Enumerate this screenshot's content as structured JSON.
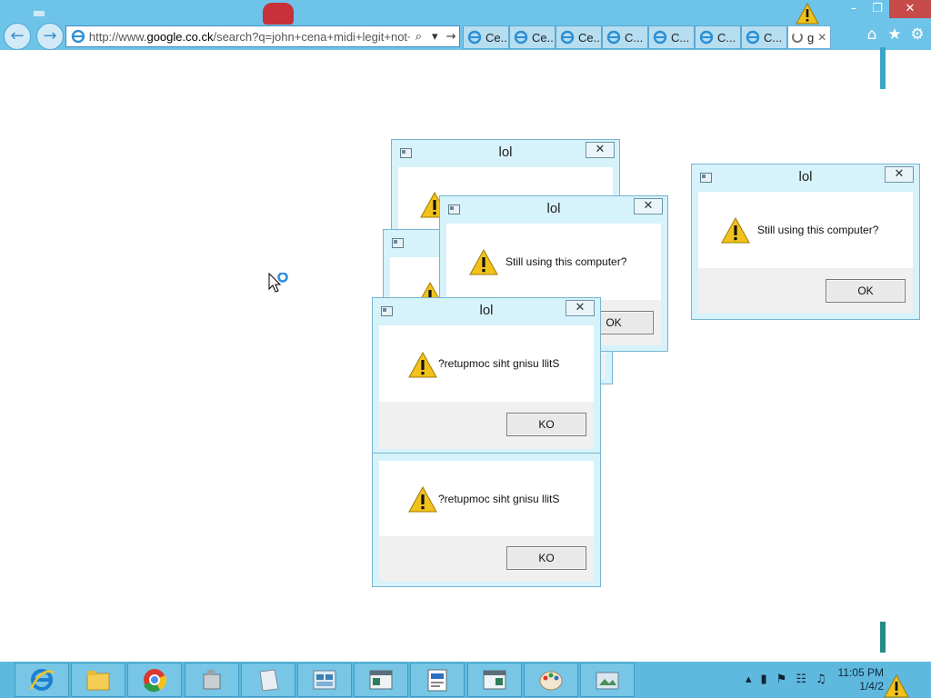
{
  "browser": {
    "address_url": "http://www.google.co.ck/search?q=john+cena+midi+legit+not+cc",
    "address_url_host": "google.co.ck",
    "address_url_prefix": "http://www.",
    "address_url_suffix": "/search?q=john+cena+midi+legit+not+cc",
    "tabs": [
      {
        "label": "Ce..."
      },
      {
        "label": "Ce..."
      },
      {
        "label": "Ce..."
      },
      {
        "label": "C..."
      },
      {
        "label": "C..."
      },
      {
        "label": "C..."
      },
      {
        "label": "C..."
      }
    ],
    "active_tab_label": "g",
    "icons": {
      "back": "back-arrow-icon",
      "forward": "forward-arrow-icon",
      "search": "search-icon",
      "home": "home-icon",
      "favorites": "star-icon",
      "settings": "gear-icon"
    }
  },
  "dialogs": [
    {
      "id": "d1",
      "title": "lol",
      "message": "",
      "button": ""
    },
    {
      "id": "d2",
      "title": "lol",
      "message": "Still using this computer?",
      "button": "OK"
    },
    {
      "id": "d3",
      "title": "",
      "message": "",
      "button": ""
    },
    {
      "id": "d4",
      "title": "lol",
      "message": "?retupmoc siht gnisu llitS",
      "button": "KO"
    },
    {
      "id": "d5",
      "title": "",
      "message": "?retupmoc siht gnisu llitS",
      "button": "KO"
    },
    {
      "id": "d6",
      "title": "lol",
      "message": "Still using this computer?",
      "button": "OK"
    }
  ],
  "taskbar": {
    "apps": [
      {
        "name": "internet-explorer"
      },
      {
        "name": "file-explorer"
      },
      {
        "name": "chrome"
      },
      {
        "name": "device-manager"
      },
      {
        "name": "paper"
      },
      {
        "name": "control-panel"
      },
      {
        "name": "window-app"
      },
      {
        "name": "wordpad"
      },
      {
        "name": "window-app-2"
      },
      {
        "name": "paint"
      },
      {
        "name": "screenshot"
      }
    ],
    "clock_time": "11:05 PM",
    "clock_date": "1/4/2"
  },
  "colors": {
    "chrome_blue": "#6ec4e8",
    "taskbar_blue": "#5fb9de",
    "dialog_border": "#78b4d0",
    "warning_yellow": "#f2c21c"
  }
}
